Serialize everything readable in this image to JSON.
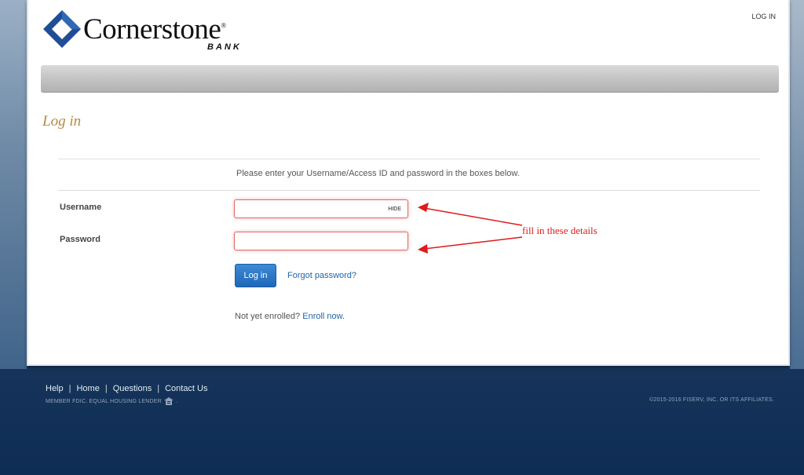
{
  "brand": {
    "name": "Cornerstone",
    "trademark": "®",
    "sub": "BANK"
  },
  "header": {
    "login_link": "LOG IN"
  },
  "page": {
    "title": "Log in"
  },
  "form": {
    "instructions": "Please enter your Username/Access ID and password in the boxes below.",
    "username_label": "Username",
    "username_value": "",
    "hide_label": "HIDE",
    "password_label": "Password",
    "password_value": "",
    "login_button": "Log in",
    "forgot_link": "Forgot password?",
    "enroll_prefix": "Not yet enrolled?",
    "enroll_link": "Enroll now",
    "enroll_suffix": "."
  },
  "annotation": {
    "text": "fill in these details",
    "color": "#e01b1b"
  },
  "footer": {
    "links": [
      "Help",
      "Home",
      "Questions",
      "Contact Us"
    ],
    "fdic": "MEMBER FDIC. EQUAL HOUSING LENDER",
    "copyright": "©2015-2016 FISERV, INC. OR ITS AFFILIATES."
  },
  "colors": {
    "title": "#b38b42",
    "link": "#1f64a8",
    "button": "#1f68b8",
    "logo": "#1f4e96"
  }
}
